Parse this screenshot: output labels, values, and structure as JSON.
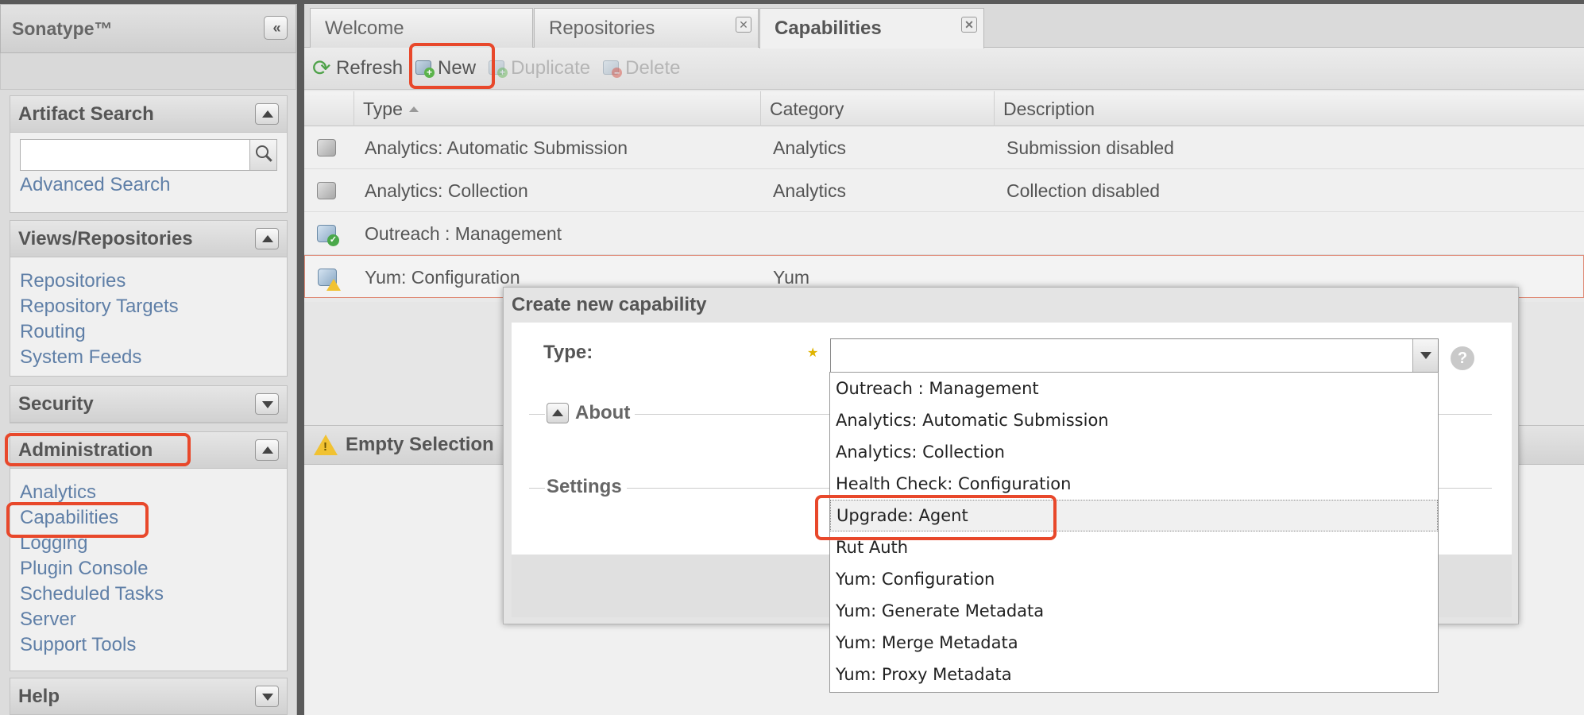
{
  "brand": {
    "title": "Sonatype™",
    "collapse_glyph": "«"
  },
  "sidebar": {
    "artifact_search": {
      "title": "Artifact Search",
      "search_value": "",
      "advanced_link": "Advanced Search"
    },
    "views": {
      "title": "Views/Repositories",
      "links": [
        "Repositories",
        "Repository Targets",
        "Routing",
        "System Feeds"
      ]
    },
    "security": {
      "title": "Security"
    },
    "administration": {
      "title": "Administration",
      "links": [
        "Analytics",
        "Capabilities",
        "Logging",
        "Plugin Console",
        "Scheduled Tasks",
        "Server",
        "Support Tools"
      ]
    },
    "help": {
      "title": "Help"
    }
  },
  "tabs": [
    {
      "label": "Welcome",
      "closable": false
    },
    {
      "label": "Repositories",
      "closable": true
    },
    {
      "label": "Capabilities",
      "closable": true,
      "active": true
    }
  ],
  "toolbar": {
    "refresh": "Refresh",
    "new": "New",
    "duplicate": "Duplicate",
    "delete": "Delete"
  },
  "grid": {
    "columns": [
      "Type",
      "Category",
      "Description"
    ],
    "rows": [
      {
        "icon": "capability-gray-icon",
        "type": "Analytics: Automatic Submission",
        "category": "Analytics",
        "description": "Submission disabled"
      },
      {
        "icon": "capability-gray-icon",
        "type": "Analytics: Collection",
        "category": "Analytics",
        "description": "Collection disabled"
      },
      {
        "icon": "capability-active-icon",
        "type": "Outreach : Management",
        "category": "",
        "description": ""
      },
      {
        "icon": "capability-warning-icon",
        "type": "Yum: Configuration",
        "category": "Yum",
        "description": ""
      }
    ]
  },
  "detail": {
    "title": "Empty Selection"
  },
  "dialog": {
    "title": "Create new capability",
    "type_label": "Type:",
    "type_value": "",
    "about_label": "About",
    "settings_label": "Settings",
    "help_glyph": "?"
  },
  "dropdown": {
    "options": [
      "Outreach : Management",
      "Analytics: Automatic Submission",
      "Analytics: Collection",
      "Health Check: Configuration",
      "Upgrade: Agent",
      "Rut Auth",
      "Yum: Configuration",
      "Yum: Generate Metadata",
      "Yum: Merge Metadata",
      "Yum: Proxy Metadata"
    ],
    "hovered": "Upgrade: Agent"
  },
  "colors": {
    "highlight": "#e8482b",
    "link": "#5f7fa7",
    "required_star": "#e0b400"
  }
}
